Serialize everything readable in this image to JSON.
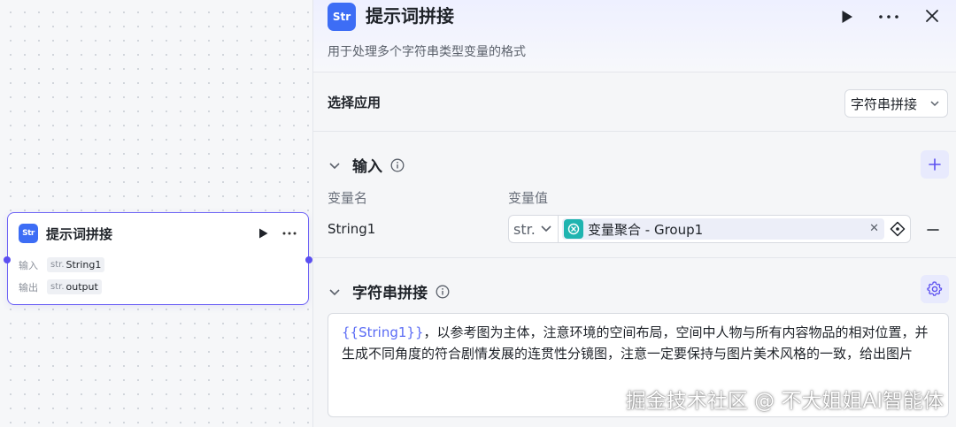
{
  "node": {
    "logo_text": "Str",
    "title": "提示词拼接",
    "input_label": "输入",
    "input_type": "str.",
    "input_value": "String1",
    "output_label": "输出",
    "output_type": "str.",
    "output_value": "output"
  },
  "panel": {
    "logo_text": "Str",
    "title": "提示词拼接",
    "description": "用于处理多个字符串类型变量的格式",
    "select_app": {
      "label": "选择应用",
      "value": "字符串拼接"
    },
    "input_section": {
      "title": "输入",
      "col_name": "变量名",
      "col_value": "变量值",
      "rows": [
        {
          "name": "String1",
          "type": "str.",
          "value_prefix": "变量聚合",
          "value_suffix": " - Group1"
        }
      ]
    },
    "concat_section": {
      "title": "字符串拼接",
      "prompt_var": "{{String1}}",
      "prompt_text": "，以参考图为主体，注意环境的空间布局，空间中人物与所有内容物品的相对位置，并生成不同角度的符合剧情发展的连贯性分镜图，注意一定要保持与图片美术风格的一致，给出图片"
    }
  },
  "watermark": "掘金技术社区 @ 不大姐姐AI智能体",
  "colors": {
    "accent": "#5b4ff0",
    "logo_bg": "#3d6df5",
    "chip_icon": "#1fb4b0",
    "var_ref": "#5b6cf5"
  }
}
